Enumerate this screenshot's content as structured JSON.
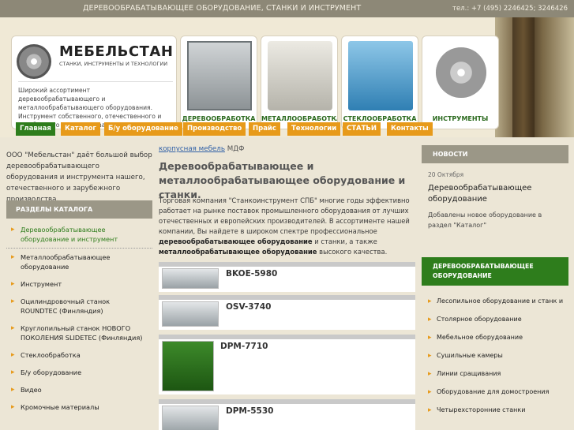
{
  "topbar": {
    "title": "ДЕРЕВООБРАБАТЫВАЮЩЕЕ ОБОРУДОВАНИЕ, СТАНКИ И ИНСТРУМЕНТ",
    "phone": "тел.: +7 (495) 2246425; 3246426"
  },
  "logo": {
    "name": "МЕБЕЛЬСТАН",
    "subtitle": "СТАНКИ, ИНСТРУМЕНТЫ И ТЕХНОЛОГИИ",
    "text": "Широкий ассортимент деревообрабатывающего и металлообрабатывающего оборудования. Инструмент собственного, отечественного и зарубежного производства."
  },
  "categories": [
    {
      "label": "ДЕРЕВООБРАБОТКА",
      "icon": "woodworking-machine-icon"
    },
    {
      "label": "МЕТАЛЛООБРАБОТКА",
      "icon": "lathe-icon"
    },
    {
      "label": "СТЕКЛООБРАБОТКА",
      "icon": "glass-machine-icon"
    },
    {
      "label": "ИНСТРУМЕНТЫ",
      "icon": "saw-blade-icon"
    }
  ],
  "nav": [
    "Главная",
    "Каталог",
    "Б/у оборудование",
    "Производство",
    "Прайс",
    "Технологии",
    "СТАТЬИ",
    "Контакты"
  ],
  "left": {
    "intro": "ООО \"Мебельстан\" даёт большой выбор деревообрабатывающего оборудования и инструмента нашего, отечественного и зарубежного производства.",
    "section_title": "РАЗДЕЛЫ КАТАЛОГА",
    "items": [
      "Деревообрабатывающее оборудование и инструмент",
      "Металлообрабатывающее оборудование",
      "Инструмент",
      "Оцилиндровочный станок ROUNDTEC (Финляндия)",
      "Круглопильный станок НОВОГО ПОКОЛЕНИЯ SLIDETEC (Финляндия)",
      "Стеклообработка",
      "Б/у оборудование",
      "Видео",
      "Кромочные материалы"
    ]
  },
  "center": {
    "breadcrumb_link": "корпусная мебель",
    "breadcrumb_rest": " МДФ",
    "title": "Деревообрабатывающее и металлообрабатывающее оборудование и станки.",
    "para_1": "Торговая компания \"Станкоинструмент СПБ\" многие годы эффективно работает на рынке поставок промышленного оборудования от лучших отечественных и европейских производителей. В ассортименте нашей компании, Вы найдете в широком спектре профессиональное ",
    "para_b1": "деревообрабатывающее оборудование",
    "para_2": " и станки, а также ",
    "para_b2": "металлообрабатывающее оборудование",
    "para_3": " высокого качества.",
    "products": [
      "BKOE-5980",
      "OSV-3740",
      "DPM-7710",
      "DPM-5530"
    ]
  },
  "right": {
    "news_title": "НОВОСТИ",
    "news_date": "20 Октября",
    "news_headline": "Деревообрабатывающее оборудование",
    "news_text": "Добавлены новое оборудование в раздел \"Каталог\"",
    "wood_title": "ДЕРЕВООБРАБАТЫВАЮЩЕЕ ОБОРУДОВАНИЕ",
    "wood_items": [
      "Лесопильное оборудование и станк и",
      "Столярное оборудование",
      "Мебельное оборудование",
      "Сушильные камеры",
      "Линии сращивания",
      "Оборудование для домостроения",
      "Четырехсторонние станки"
    ]
  },
  "colors": {
    "accent": "#e79a1a",
    "green": "#2e7d1c",
    "panel": "#9b9787"
  }
}
